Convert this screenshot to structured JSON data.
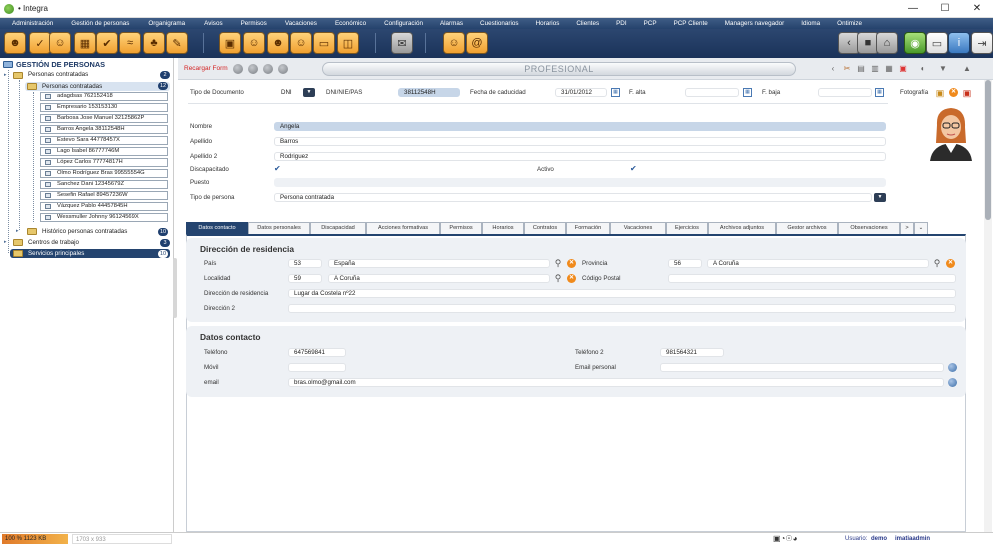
{
  "window": {
    "title": "• Integra",
    "buttons": [
      "—",
      "☐",
      "✕"
    ]
  },
  "menu": [
    "Administración",
    "Gestión de personas",
    "Organigrama",
    "Avisos",
    "Permisos",
    "Vacaciones",
    "Económico",
    "Configuración",
    "Alarmas",
    "Cuestionarios",
    "Horarios",
    "Clientes",
    "PDI",
    "PCP",
    "PCP Cliente",
    "Managers navegador",
    "Idioma",
    "Ontimize"
  ],
  "sidebar": {
    "root": "GESTIÓN DE PERSONAS",
    "group1": {
      "label": "Personas contratadas",
      "count": "2"
    },
    "group1_child": {
      "label": "Personas contratadas",
      "count": "12"
    },
    "people": [
      "adagdsas 762152418",
      "Empresario 153153130",
      "Barbosa Jose Manuel 32125862P",
      "Barros Angela 38112548H",
      "Estevo Sara 44778457X",
      "Lago Isabel 86777746M",
      "López Carlos 77774817H",
      "Olmo Rodríguez Bras 99555554G",
      "Sanchez Dani 12345679Z",
      "Sesefin Rafael 89457236W",
      "Vázquez Pablo 44457845H",
      "Wessmuller Johnny 96124569X"
    ],
    "historic": {
      "label": "Histórico personas contratadas",
      "count": "10"
    },
    "work_centers": {
      "label": "Centros de trabajo",
      "count": "3"
    },
    "main_services": {
      "label": "Servicios principales",
      "count": "10"
    }
  },
  "form": {
    "reload": "Recargar Form",
    "title": "PROFESIONAL",
    "doc_type_label": "Tipo de Documento",
    "doc_type_value": "DNI",
    "dni_label": "DNI/NIE/PAS",
    "dni_value": "38112548H",
    "expiry_label": "Fecha de caducidad",
    "expiry_value": "31/01/2012",
    "f_alta_label": "F. alta",
    "f_baja_label": "F. baja",
    "photo_label": "Fotografía",
    "name_label": "Nombre",
    "name_value": "Angela",
    "surname1_label": "Apellido",
    "surname1_value": "Barros",
    "surname2_label": "Apellido 2",
    "surname2_value": "Rodriguez",
    "disabled_label": "Discapacitado",
    "active_label": "Activo",
    "position_label": "Puesto",
    "person_type_label": "Tipo de persona",
    "person_type_value": "Persona contratada"
  },
  "tabs": [
    "Datos contacto",
    "Datos personales",
    "Discapacidad",
    "Acciones formativas",
    "Permisos",
    "Horarios",
    "Contratos",
    "Formación",
    "Vacaciones",
    "Ejercicios",
    "Archivos adjuntos",
    "Gestor archivos",
    "Observaciones",
    ">",
    "⌄"
  ],
  "residence": {
    "title": "Dirección de residencia",
    "country_label": "País",
    "country_code": "53",
    "country_value": "España",
    "province_label": "Provincia",
    "province_code": "56",
    "province_value": "A Coruña",
    "locality_label": "Localidad",
    "locality_code": "59",
    "locality_value": "A Coruña",
    "postal_label": "Código Postal",
    "address_label": "Dirección de residencia",
    "address_value": "Lugar da Costela nº22",
    "address2_label": "Dirección 2"
  },
  "contact": {
    "title": "Datos contacto",
    "phone_label": "Teléfono",
    "phone_value": "647569841",
    "phone2_label": "Teléfono 2",
    "phone2_value": "981564321",
    "mobile_label": "Móvil",
    "personal_email_label": "Email personal",
    "email_label": "email",
    "email_value": "bras.olmo@gmail.com"
  },
  "status": {
    "memory": "100 %  1123 KB",
    "resolution": "1703 x 933",
    "user_label": "Usuario:",
    "user_value": "demo",
    "admin": "imatiaadmin"
  },
  "colors": {
    "menubar": "#2c4a76",
    "accent": "#24446f",
    "reload": "#d32323",
    "badge": "#1f3f6e"
  }
}
